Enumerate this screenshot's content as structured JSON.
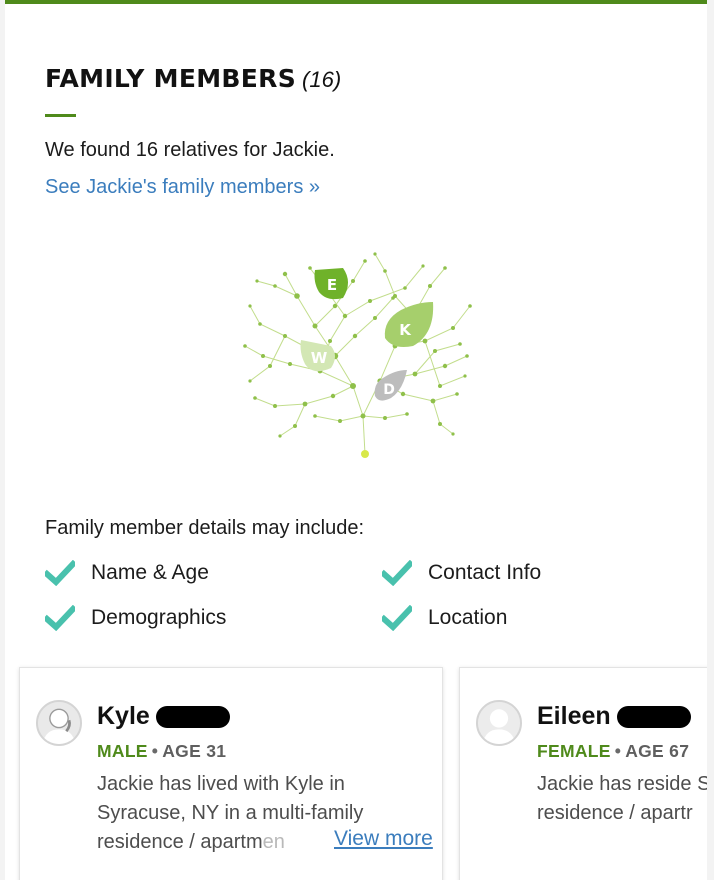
{
  "section": {
    "title": "FAMILY MEMBERS",
    "count": "(16)",
    "found_text": "We found 16 relatives for Jackie.",
    "see_link": "See Jackie's family members »"
  },
  "tree": {
    "leaves": [
      {
        "letter": "E",
        "color": "#6fb22a"
      },
      {
        "letter": "K",
        "color": "#a6cf6c"
      },
      {
        "letter": "W",
        "color": "#d3e7b4"
      },
      {
        "letter": "D",
        "color": "#bdbdbd"
      }
    ]
  },
  "details": {
    "intro": "Family member details may include:",
    "items": [
      "Name & Age",
      "Contact Info",
      "Demographics",
      "Location"
    ]
  },
  "cards": [
    {
      "name": "Kyle",
      "gender": "MALE",
      "sep": "•",
      "age": "AGE 31",
      "desc_main": "Jackie has lived with Kyle in Syracuse, NY in a multi-family residence / apartm",
      "desc_fade": "en",
      "view_more": "View more"
    },
    {
      "name": "Eileen",
      "gender": "FEMALE",
      "sep": "•",
      "age": "AGE 67",
      "desc_main": "Jackie has reside Syracuse, NY in a residence / apartr",
      "desc_fade": ""
    }
  ],
  "colors": {
    "accent_green": "#4f8a1b",
    "link_blue": "#3b7dbd",
    "check_teal": "#49c1ad"
  }
}
